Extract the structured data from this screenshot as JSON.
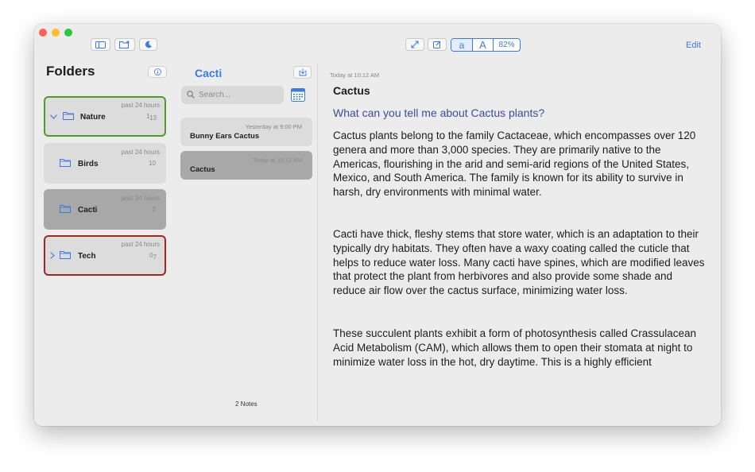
{
  "toolbar": {
    "segment_small": "a",
    "segment_large": "A",
    "zoom": "82%",
    "edit_label": "Edit"
  },
  "sidebar": {
    "title": "Folders",
    "folders": [
      {
        "name": "Nature",
        "time": "past 24 hours",
        "count_main": "1",
        "count_sub": "13"
      },
      {
        "name": "Birds",
        "time": "past 24 hours",
        "count_main": "10"
      },
      {
        "name": "Cacti",
        "time": "past 24 hours",
        "count_main": "2"
      },
      {
        "name": "Tech",
        "time": "past 24 hours",
        "count_main": "0",
        "count_sub": "7"
      }
    ]
  },
  "notes_list": {
    "title": "Cacti",
    "search_placeholder": "Search...",
    "notes": [
      {
        "title": "Bunny Ears Cactus",
        "time": "Yesterday at 9:00 PM"
      },
      {
        "title": "Cactus",
        "time": "Today at 10:12 AM"
      }
    ],
    "count_label": "2 Notes"
  },
  "editor": {
    "date": "Today at 10:12 AM",
    "title": "Cactus",
    "question": "What can you tell me about Cactus plants?",
    "paragraphs": [
      "Cactus plants belong to the family Cactaceae, which encompasses over 120 genera and more than 3,000 species. They are primarily native to the Americas, flourishing in the arid and semi-arid regions of the United States, Mexico, and South America. The family is known for its ability to survive in harsh, dry environments with minimal water.",
      "Cacti have thick, fleshy stems that store water, which is an adaptation to their typically dry habitats. They often have a waxy coating called the cuticle that helps to reduce water loss. Many cacti have spines, which are modified leaves that protect the plant from herbivores and also provide some shade and reduce air flow over the cactus surface, minimizing water loss.",
      "These succulent plants exhibit a form of photosynthesis called Crassulacean Acid Metabolism (CAM), which allows them to open their stomata at night to minimize water loss in the hot, dry daytime. This is a highly efficient"
    ]
  },
  "colors": {
    "accent": "#3b7be4",
    "nature_border": "#4f9a2a",
    "tech_border": "#a3261f",
    "selected_card": "#a8a8a8",
    "question": "#3a4f9c"
  },
  "icons": [
    "sidebar-toggle-icon",
    "new-folder-icon",
    "moon-icon",
    "expand-icon",
    "compose-icon",
    "info-icon",
    "import-icon",
    "search-icon",
    "calendar-icon",
    "folder-icon",
    "chevron-down-icon",
    "chevron-right-icon"
  ]
}
